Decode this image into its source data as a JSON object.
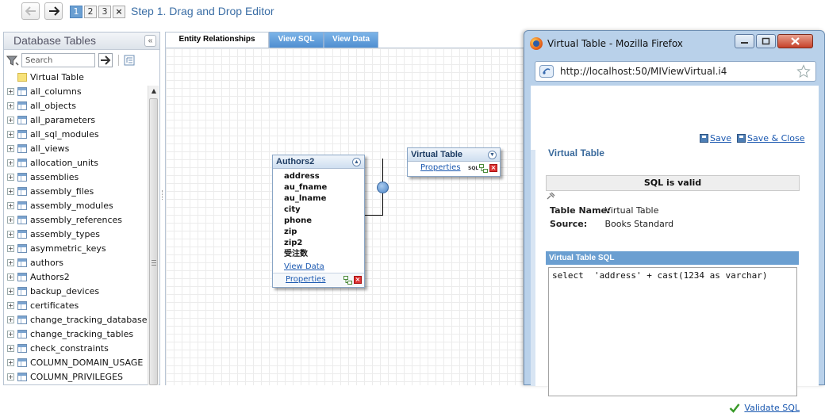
{
  "wizard": {
    "steps": [
      "1",
      "2",
      "3"
    ],
    "close_symbol": "×",
    "title": "Step 1. Drag and Drop Editor"
  },
  "left_panel": {
    "title": "Database Tables",
    "search_placeholder": "Search",
    "items": [
      {
        "label": "Virtual Table",
        "icon": "virtual-table-icon"
      },
      {
        "label": "all_columns",
        "icon": "table-icon"
      },
      {
        "label": "all_objects",
        "icon": "table-icon"
      },
      {
        "label": "all_parameters",
        "icon": "table-icon"
      },
      {
        "label": "all_sql_modules",
        "icon": "table-icon"
      },
      {
        "label": "all_views",
        "icon": "table-icon"
      },
      {
        "label": "allocation_units",
        "icon": "table-icon"
      },
      {
        "label": "assemblies",
        "icon": "table-icon"
      },
      {
        "label": "assembly_files",
        "icon": "table-icon"
      },
      {
        "label": "assembly_modules",
        "icon": "table-icon"
      },
      {
        "label": "assembly_references",
        "icon": "table-icon"
      },
      {
        "label": "assembly_types",
        "icon": "table-icon"
      },
      {
        "label": "asymmetric_keys",
        "icon": "table-icon"
      },
      {
        "label": "authors",
        "icon": "table-icon"
      },
      {
        "label": "Authors2",
        "icon": "table-icon"
      },
      {
        "label": "backup_devices",
        "icon": "table-icon"
      },
      {
        "label": "certificates",
        "icon": "table-icon"
      },
      {
        "label": "change_tracking_databases",
        "icon": "table-icon"
      },
      {
        "label": "change_tracking_tables",
        "icon": "table-icon"
      },
      {
        "label": "check_constraints",
        "icon": "table-icon"
      },
      {
        "label": "COLUMN_DOMAIN_USAGE",
        "icon": "table-icon"
      },
      {
        "label": "COLUMN_PRIVILEGES",
        "icon": "table-icon"
      }
    ]
  },
  "tabs": [
    "Entity Relationships",
    "View SQL",
    "View Data"
  ],
  "entities": {
    "authors2": {
      "title": "Authors2",
      "fields": [
        "address",
        "au_fname",
        "au_lname",
        "city",
        "phone",
        "zip",
        "zip2",
        "受注数"
      ],
      "view_data": "View Data",
      "properties": "Properties"
    },
    "virtual_table": {
      "title": "Virtual Table",
      "properties": "Properties",
      "sql_badge": "SQL"
    }
  },
  "popup": {
    "window_title": "Virtual Table - Mozilla Firefox",
    "url": "http://localhost:50/MIViewVirtual.i4",
    "save": "Save",
    "save_close": "Save & Close",
    "heading": "Virtual Table",
    "status": "SQL is valid",
    "table_name_label": "Table Name:",
    "table_name": "Virtual Table",
    "source_label": "Source:",
    "source": "Books Standard",
    "sql_header": "Virtual Table SQL",
    "sql": "select  'address' + cast(1234 as varchar)",
    "validate": "Validate SQL"
  },
  "colors": {
    "accent": "#3b6ea5",
    "tab_inactive": "#5a97d6",
    "sql_header": "#6b9fd1",
    "link": "#1a58b0"
  }
}
